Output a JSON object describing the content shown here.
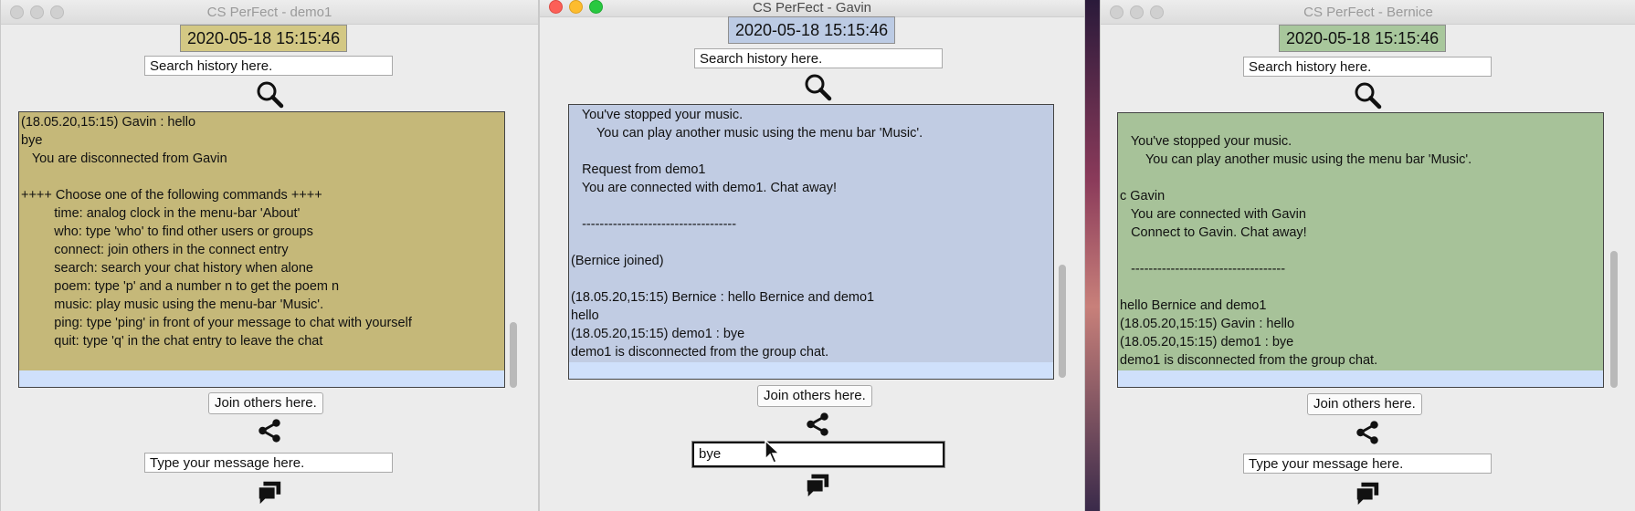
{
  "colors": {
    "demo1_bg": "#c5b879",
    "demo1_date_bg": "#d3c884",
    "gavin_bg": "#c1cce3",
    "gavin_date_bg": "#bccbe4",
    "bernice_bg": "#a7c299",
    "bernice_date_bg": "#a8c79c",
    "selection": "#cfe0fb"
  },
  "windows": {
    "demo1": {
      "title": "CS PerFect - demo1",
      "datetime": "2020-05-18 15:15:46",
      "search_placeholder": "Search history here.",
      "search_icon": "magnifier-icon",
      "chat_lines": [
        "(18.05.20,15:15) Gavin : hello",
        "bye",
        "   You are disconnected from Gavin",
        "",
        "++++ Choose one of the following commands ++++",
        "         time: analog clock in the menu-bar 'About'",
        "         who: type 'who' to find other users or groups",
        "         connect: join others in the connect entry",
        "         search: search your chat history when alone",
        "         poem: type 'p' and a number n to get the poem n",
        "         music: play music using the menu-bar 'Music'.",
        "         ping: type 'ping' in front of your message to chat with yourself",
        "         quit: type 'q' in the chat entry to leave the chat"
      ],
      "join_label": "Join others here.",
      "join_icon": "share-icon",
      "message_value": "Type your message here.",
      "send_icon": "chat-bubbles-icon"
    },
    "gavin": {
      "title": "CS PerFect - Gavin",
      "datetime": "2020-05-18 15:15:46",
      "search_placeholder": "Search history here.",
      "search_icon": "magnifier-icon",
      "chat_lines": [
        "   You've stopped your music.",
        "       You can play another music using the menu bar 'Music'.",
        "",
        "   Request from demo1",
        "   You are connected with demo1. Chat away!",
        "",
        "   -----------------------------------",
        "",
        "(Bernice joined)",
        "",
        "(18.05.20,15:15) Bernice : hello Bernice and demo1",
        "hello",
        "(18.05.20,15:15) demo1 : bye",
        "demo1 is disconnected from the group chat."
      ],
      "join_label": "Join others here.",
      "join_icon": "share-icon",
      "message_value": "bye",
      "send_icon": "chat-bubbles-icon"
    },
    "bernice": {
      "title": "CS PerFect - Bernice",
      "datetime": "2020-05-18 15:15:46",
      "search_placeholder": "Search history here.",
      "search_icon": "magnifier-icon",
      "chat_lines": [
        "",
        "   You've stopped your music.",
        "       You can play another music using the menu bar 'Music'.",
        "",
        "c Gavin",
        "   You are connected with Gavin",
        "   Connect to Gavin. Chat away!",
        "",
        "   -----------------------------------",
        "",
        "hello Bernice and demo1",
        "(18.05.20,15:15) Gavin : hello",
        "(18.05.20,15:15) demo1 : bye",
        "demo1 is disconnected from the group chat."
      ],
      "join_label": "Join others here.",
      "join_icon": "share-icon",
      "message_value": "Type your message here.",
      "send_icon": "chat-bubbles-icon"
    }
  }
}
